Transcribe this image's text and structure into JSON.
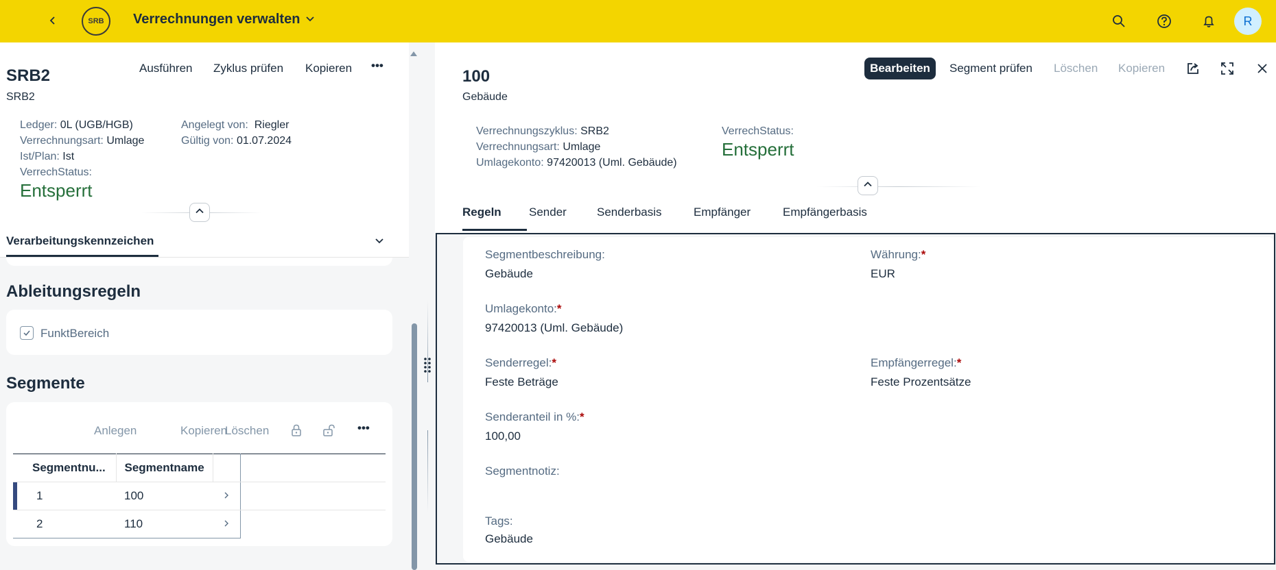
{
  "shell": {
    "logo_text": "SRB",
    "title": "Verrechnungen verwalten",
    "avatar_initial": "R"
  },
  "left": {
    "title": "SRB2",
    "subtitle": "SRB2",
    "toolbar": {
      "execute": "Ausführen",
      "check_cycle": "Zyklus prüfen",
      "copy": "Kopieren",
      "more": "•••"
    },
    "attributes": {
      "ledger_label": "Ledger:",
      "ledger_value": "0L (UGB/HGB)",
      "alloc_type_label": "Verrechnungsart:",
      "alloc_type_value": "Umlage",
      "actual_plan_label": "Ist/Plan:",
      "actual_plan_value": "Ist",
      "status_label": "VerrechStatus:",
      "status_value": "Entsperrt",
      "created_by_label": "Angelegt von:",
      "created_by_value": "Riegler",
      "valid_from_label": "Gültig von:",
      "valid_from_value": "01.07.2024"
    },
    "tab_active": "Verarbeitungskennzeichen",
    "derivation": {
      "title": "Ableitungsregeln",
      "checkbox_label": "FunktBereich"
    },
    "segments": {
      "title": "Segmente",
      "toolbar": {
        "create": "Anlegen",
        "copy": "Kopieren",
        "delete": "Löschen",
        "more": "•••"
      },
      "columns": [
        "Segmentnu...",
        "Segmentname"
      ],
      "rows": [
        {
          "number": "1",
          "name": "100"
        },
        {
          "number": "2",
          "name": "110"
        }
      ]
    }
  },
  "right": {
    "title": "100",
    "subtitle": "Gebäude",
    "toolbar": {
      "edit": "Bearbeiten",
      "check_segment": "Segment prüfen",
      "delete": "Löschen",
      "copy": "Kopieren"
    },
    "attributes": {
      "cycle_label": "Verrechnungszyklus:",
      "cycle_value": "SRB2",
      "alloc_type_label": "Verrechnungsart:",
      "alloc_type_value": "Umlage",
      "account_label": "Umlagekonto:",
      "account_value": "97420013 (Uml. Gebäude)",
      "status_label": "VerrechStatus:",
      "status_value": "Entsperrt"
    },
    "tabs": [
      "Regeln",
      "Sender",
      "Senderbasis",
      "Empfänger",
      "Empfängerbasis"
    ],
    "form": {
      "seg_desc_label": "Segmentbeschreibung:",
      "seg_desc_value": "Gebäude",
      "currency_label": "Währung:",
      "currency_value": "EUR",
      "account_label": "Umlagekonto:",
      "account_value": "97420013 (Uml. Gebäude)",
      "sender_rule_label": "Senderregel:",
      "sender_rule_value": "Feste Beträge",
      "receiver_rule_label": "Empfängerregel:",
      "receiver_rule_value": "Feste Prozentsätze",
      "sender_share_label": "Senderanteil in %:",
      "sender_share_value": "100,00",
      "note_label": "Segmentnotiz:",
      "tags_label": "Tags:",
      "tags_value": "Gebäude",
      "required_mark": "*"
    }
  },
  "colors": {
    "shell": "#f3d500",
    "text": "#1d2d3e",
    "positive": "#256f3a",
    "emphasized": "#1d2d3e"
  }
}
